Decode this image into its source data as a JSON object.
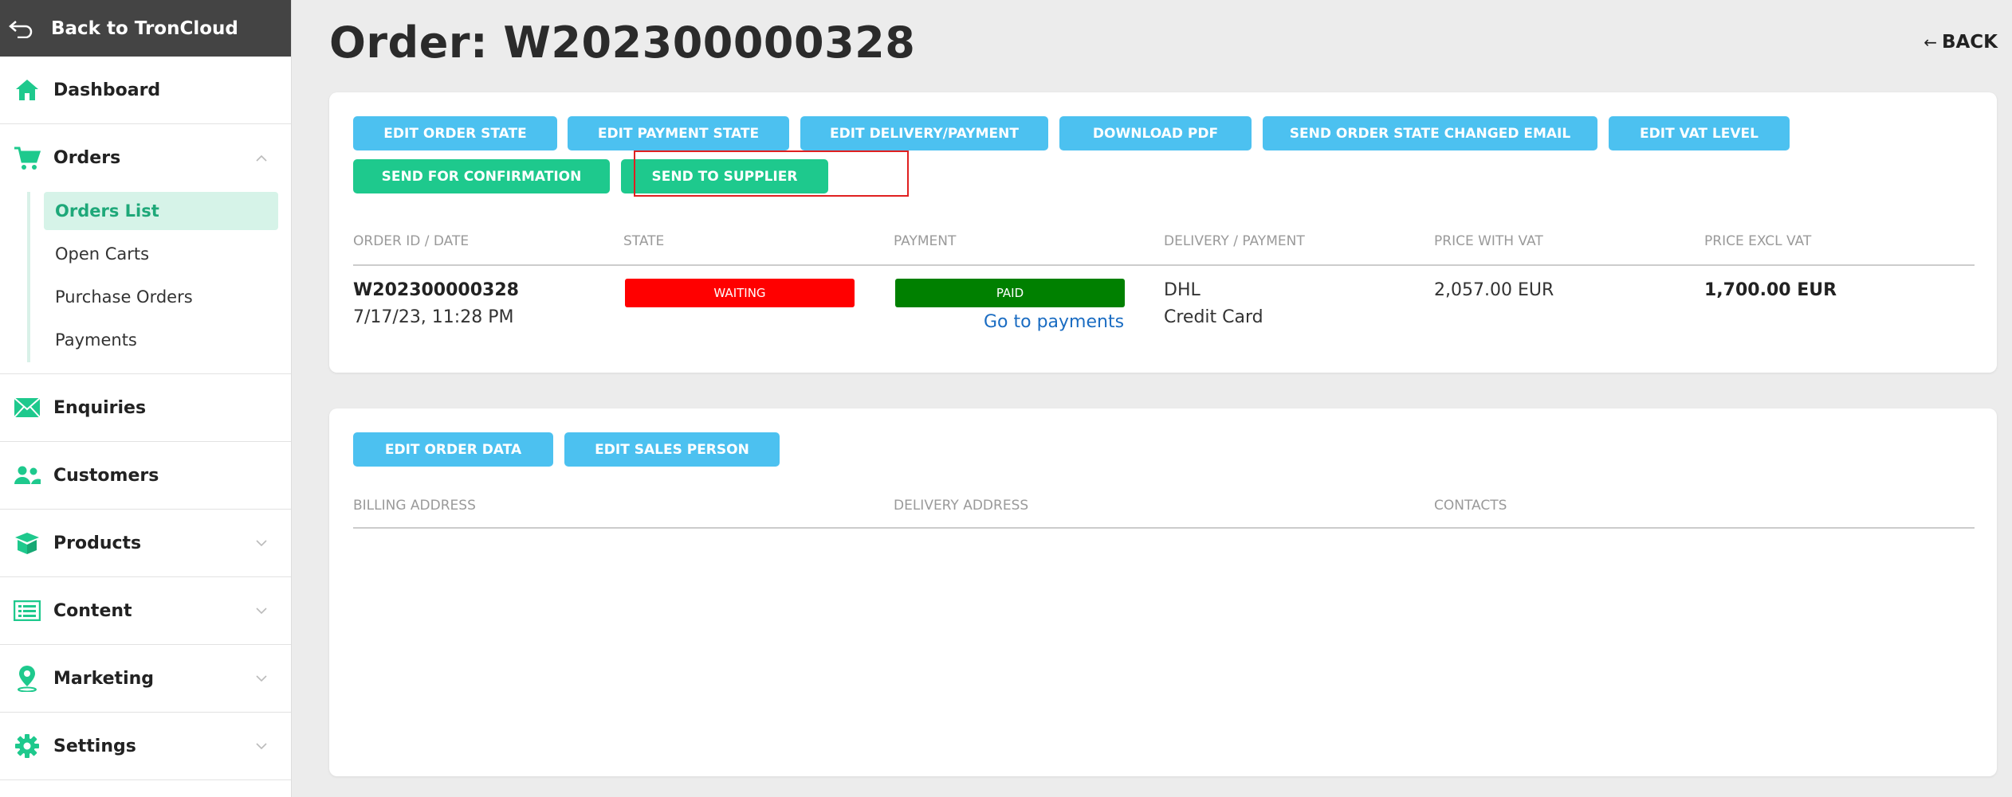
{
  "sidebar": {
    "back_label": "Back to TronCloud",
    "items": [
      {
        "label": "Dashboard",
        "icon": "home-icon"
      },
      {
        "label": "Orders",
        "icon": "cart-icon",
        "expanded": true
      },
      {
        "label": "Enquiries",
        "icon": "mail-icon"
      },
      {
        "label": "Customers",
        "icon": "users-icon"
      },
      {
        "label": "Products",
        "icon": "box-icon"
      },
      {
        "label": "Content",
        "icon": "list-icon"
      },
      {
        "label": "Marketing",
        "icon": "pin-icon"
      },
      {
        "label": "Settings",
        "icon": "gear-icon"
      }
    ],
    "orders_sub": [
      {
        "label": "Orders List",
        "active": true
      },
      {
        "label": "Open Carts"
      },
      {
        "label": "Purchase Orders"
      },
      {
        "label": "Payments"
      }
    ]
  },
  "header": {
    "title": "Order: W202300000328",
    "back_label": "BACK"
  },
  "order_actions": [
    "EDIT ORDER STATE",
    "EDIT PAYMENT STATE",
    "EDIT DELIVERY/PAYMENT",
    "DOWNLOAD PDF",
    "SEND ORDER STATE CHANGED EMAIL",
    "EDIT VAT LEVEL",
    "SEND FOR CONFIRMATION",
    "SEND TO SUPPLIER"
  ],
  "order_table": {
    "columns": [
      "ORDER ID / DATE",
      "STATE",
      "PAYMENT",
      "DELIVERY / PAYMENT",
      "PRICE WITH VAT",
      "PRICE EXCL VAT"
    ],
    "row": {
      "order_id": "W202300000328",
      "date": "7/17/23, 11:28 PM",
      "state": "WAITING",
      "payment": "PAID",
      "payment_link": "Go to payments",
      "delivery": "DHL",
      "payment_method": "Credit Card",
      "price_with_vat": "2,057.00 EUR",
      "price_excl_vat": "1,700.00 EUR"
    }
  },
  "data_actions": [
    "EDIT ORDER DATA",
    "EDIT SALES PERSON"
  ],
  "address_table": {
    "columns": [
      "BILLING ADDRESS",
      "DELIVERY ADDRESS",
      "CONTACTS"
    ]
  },
  "colors": {
    "accent_green": "#1ec98d",
    "button_blue": "#4cc1f0",
    "state_waiting": "#ff0000",
    "state_paid": "#008000",
    "highlight": "#e02020"
  }
}
